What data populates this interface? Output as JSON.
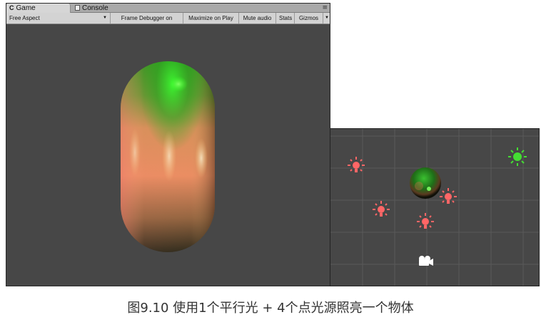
{
  "game_window": {
    "tabs": [
      {
        "label": "Game",
        "active": true,
        "icon": "unity-game-icon"
      },
      {
        "label": "Console",
        "active": false,
        "icon": "console-icon"
      }
    ],
    "toolbar": {
      "aspect_label": "Free Aspect",
      "frame_debugger_label": "Frame Debugger on",
      "maximize_label": "Maximize on Play",
      "mute_label": "Mute audio",
      "stats_label": "Stats",
      "gizmos_label": "Gizmos"
    }
  },
  "scene": {
    "point_light_color": "#ff6666",
    "directional_light_color": "#44dd33",
    "camera_icon": "camera-icon"
  },
  "colors": {
    "background": "#474747",
    "capsule_green": "#2fa52a",
    "capsule_orange": "#f2966a"
  },
  "caption": "图9.10 使用1个平行光 + 4个点光源照亮一个物体"
}
